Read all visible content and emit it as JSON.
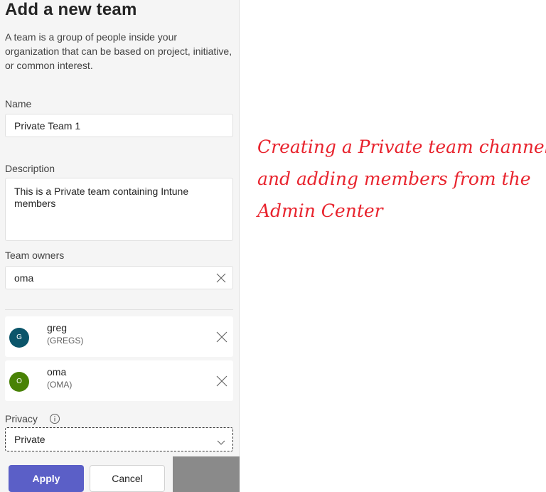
{
  "panel": {
    "title": "Add a new team",
    "intro": "A team is a group of people inside your organization that can be based on project, initiative, or common interest.",
    "name": {
      "label": "Name",
      "value": "Private Team 1"
    },
    "description": {
      "label": "Description",
      "value": "This is a Private team containing Intune members"
    },
    "owners": {
      "label": "Team owners",
      "search_value": "oma",
      "members": [
        {
          "initial": "G",
          "name": "greg",
          "id": "(GREGS)",
          "color": "#0b556a"
        },
        {
          "initial": "O",
          "name": "oma",
          "id": "(OMA)",
          "color": "#498205"
        }
      ]
    },
    "privacy": {
      "label": "Privacy",
      "value": "Private"
    },
    "apply_label": "Apply",
    "cancel_label": "Cancel"
  },
  "caption": {
    "line1": "Creating a Private team channel",
    "line2": "and adding members from the",
    "line3": "Admin Center"
  },
  "colors": {
    "accent": "#5b5fc7",
    "caption": "#e8232d"
  }
}
